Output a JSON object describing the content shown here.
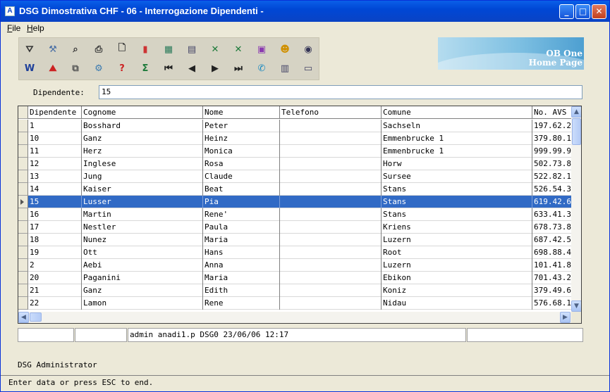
{
  "window": {
    "title": "DSG Dimostrativa CHF - 06 - Interrogazione Dipendenti -"
  },
  "menu": [
    {
      "label": "File"
    },
    {
      "label": "Help"
    }
  ],
  "toolbar": {
    "row1": [
      "filter-icon",
      "tools-icon",
      "search-icon",
      "print-icon",
      "new-page-icon",
      "chart-icon",
      "calculator-icon",
      "calendar-icon",
      "excel-icon",
      "excel-export-icon",
      "image-icon",
      "user-icon",
      "settings-icon"
    ],
    "row2": [
      "word-icon",
      "pdf-icon",
      "copy-icon",
      "gears-icon",
      "help-icon",
      "sum-icon",
      "first-record-icon",
      "previous-record-icon",
      "next-record-icon",
      "last-record-icon",
      "phone-icon",
      "calculator-small-icon",
      "window-icon"
    ]
  },
  "banner": {
    "line1": "OB One",
    "line2": "Home Page"
  },
  "filter": {
    "label": "Dipendente:",
    "value": "15"
  },
  "table": {
    "columns": [
      "Dipendente",
      "Cognome",
      "Nome",
      "Telefono",
      "Comune",
      "No. AVS"
    ],
    "selected_row": 6,
    "rows": [
      [
        "1",
        "Bosshard",
        "Peter",
        "",
        "Sachseln",
        "197.62.2"
      ],
      [
        "10",
        "Ganz",
        "Heinz",
        "",
        "Emmenbrucke 1",
        "379.80.1"
      ],
      [
        "11",
        "Herz",
        "Monica",
        "",
        "Emmenbrucke 1",
        "999.99.9"
      ],
      [
        "12",
        "Inglese",
        "Rosa",
        "",
        "Horw",
        "502.73.8"
      ],
      [
        "13",
        "Jung",
        "Claude",
        "",
        "Sursee",
        "522.82.1"
      ],
      [
        "14",
        "Kaiser",
        "Beat",
        "",
        "Stans",
        "526.54.3"
      ],
      [
        "15",
        "Lusser",
        "Pia",
        "",
        "Stans",
        "619.42.6"
      ],
      [
        "16",
        "Martin",
        "Rene'",
        "",
        "Stans",
        "633.41.3"
      ],
      [
        "17",
        "Nestler",
        "Paula",
        "",
        "Kriens",
        "678.73.8"
      ],
      [
        "18",
        "Nunez",
        "Maria",
        "",
        "Luzern",
        "687.42.5"
      ],
      [
        "19",
        "Ott",
        "Hans",
        "",
        "Root",
        "698.88.4"
      ],
      [
        "2",
        "Aebi",
        "Anna",
        "",
        "Luzern",
        "101.41.8"
      ],
      [
        "20",
        "Paganini",
        "Maria",
        "",
        "Ebikon",
        "701.43.2"
      ],
      [
        "21",
        "Ganz",
        "Edith",
        "",
        "Koniz",
        "379.49.6"
      ],
      [
        "22",
        "Lamon",
        "Rene",
        "",
        "Nidau",
        "576.68.1"
      ]
    ]
  },
  "status": {
    "panel1": "",
    "panel2": "",
    "info": "admin anadi1.p DSG0 23/06/06 12:17",
    "panel4": ""
  },
  "user": "DSG Administrator",
  "message": "Enter data or press ESC to end."
}
